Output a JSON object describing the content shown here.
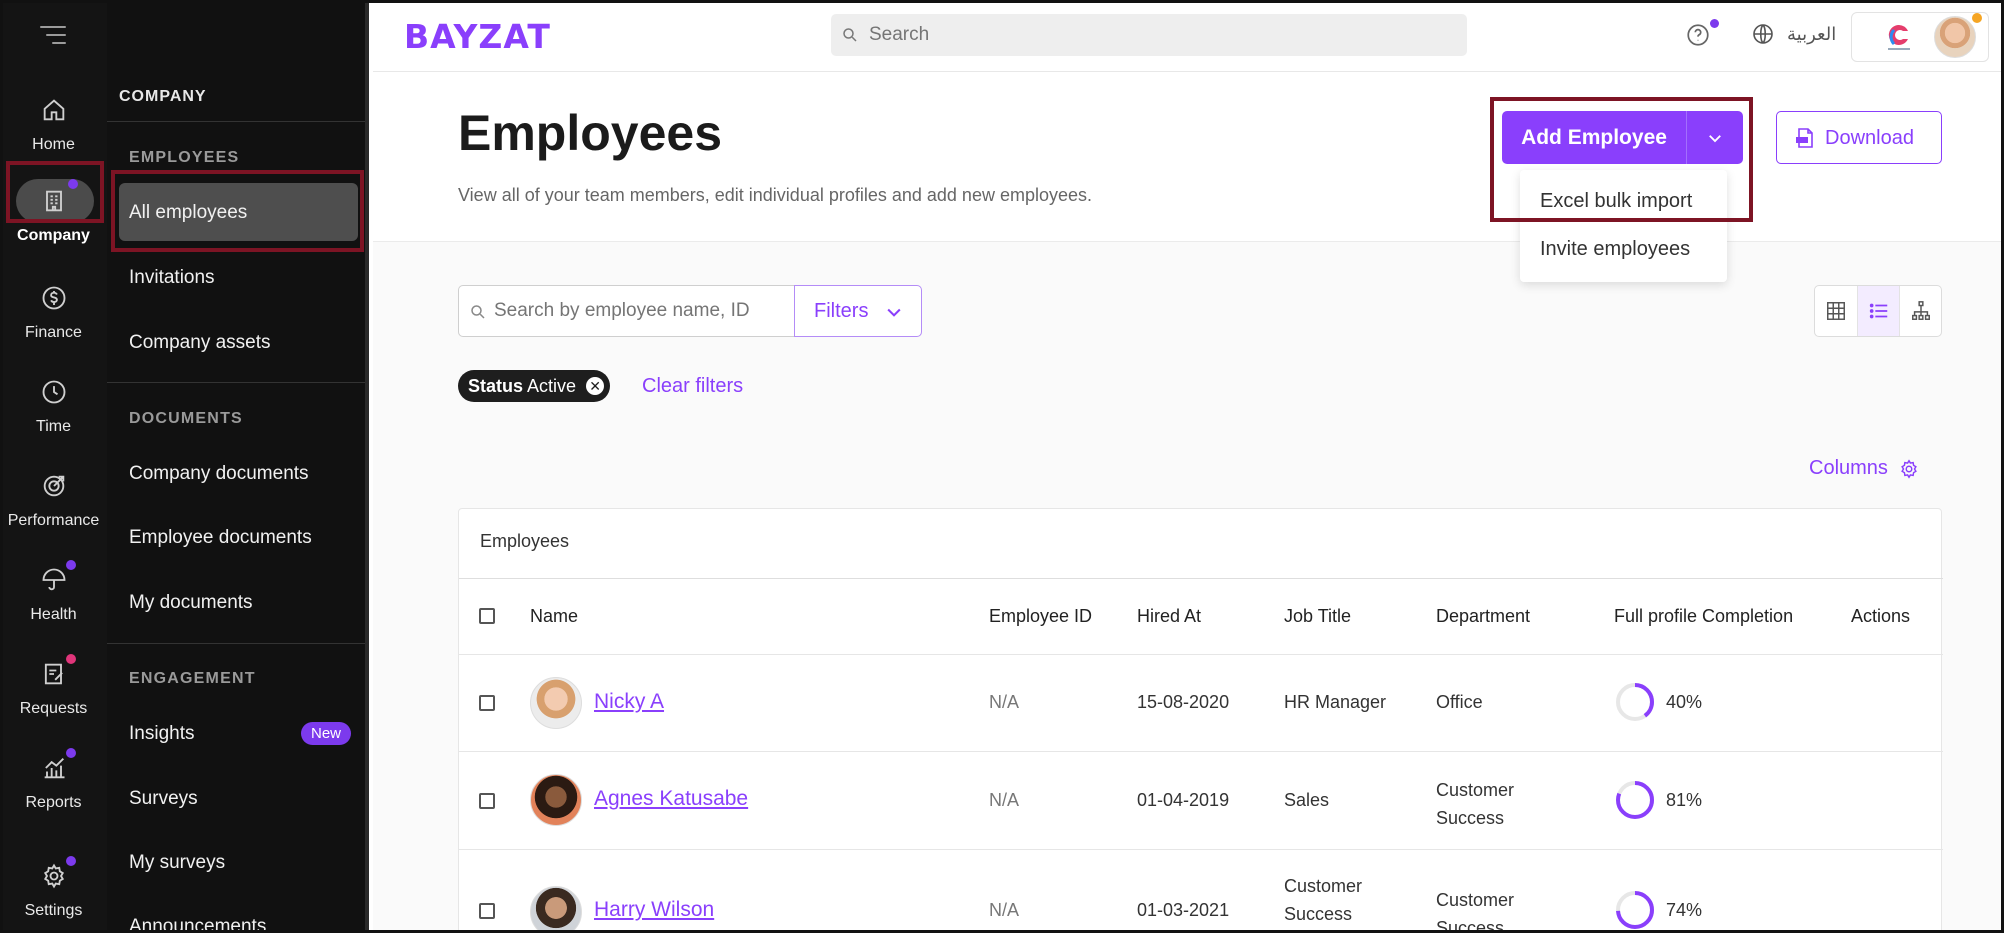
{
  "rail": {
    "items": [
      {
        "label": "Home",
        "icon": "home-icon"
      },
      {
        "label": "Company",
        "icon": "building-icon",
        "active": true
      },
      {
        "label": "Finance",
        "icon": "dollar-icon"
      },
      {
        "label": "Time",
        "icon": "clock-icon"
      },
      {
        "label": "Performance",
        "icon": "target-icon"
      },
      {
        "label": "Health",
        "icon": "umbrella-icon"
      },
      {
        "label": "Requests",
        "icon": "clipboard-icon"
      },
      {
        "label": "Reports",
        "icon": "chart-icon"
      },
      {
        "label": "Settings",
        "icon": "gear-icon"
      }
    ]
  },
  "subnav": {
    "title": "COMPANY",
    "sections": {
      "employees": "EMPLOYEES",
      "documents": "DOCUMENTS",
      "engagement": "ENGAGEMENT"
    },
    "items": {
      "all_employees": "All employees",
      "invitations": "Invitations",
      "company_assets": "Company assets",
      "company_documents": "Company documents",
      "employee_documents": "Employee documents",
      "my_documents": "My documents",
      "insights": "Insights",
      "insights_badge": "New",
      "surveys": "Surveys",
      "my_surveys": "My surveys",
      "announcements": "Announcements"
    }
  },
  "topbar": {
    "logo": "BAYZAT",
    "search_placeholder": "Search",
    "language": "العربية"
  },
  "header": {
    "title": "Employees",
    "subtitle": "View all of your team members, edit individual profiles and add new employees.",
    "add_button": "Add Employee",
    "download_button": "Download",
    "dropdown": [
      "Excel bulk import",
      "Invite employees"
    ]
  },
  "filters": {
    "search_placeholder": "Search by employee name, ID",
    "filters_button": "Filters",
    "chip_key": "Status",
    "chip_value": "Active",
    "clear": "Clear filters",
    "columns": "Columns"
  },
  "table": {
    "caption": "Employees",
    "headers": {
      "name": "Name",
      "employee_id": "Employee ID",
      "hired_at": "Hired At",
      "job_title": "Job Title",
      "department": "Department",
      "completion": "Full profile Completion",
      "actions": "Actions"
    },
    "rows": [
      {
        "name": "Nicky A",
        "employee_id": "N/A",
        "hired_at": "15-08-2020",
        "job_title": "HR Manager",
        "department": "Office",
        "completion": "40%",
        "completion_value": 0.4
      },
      {
        "name": "Agnes Katusabe",
        "employee_id": "N/A",
        "hired_at": "01-04-2019",
        "job_title": "Sales",
        "department": "Customer Success",
        "completion": "81%",
        "completion_value": 0.81
      },
      {
        "name": "Harry Wilson",
        "employee_id": "N/A",
        "hired_at": "01-03-2021",
        "job_title": "Customer Success",
        "department": "Customer Success",
        "completion": "74%",
        "completion_value": 0.74
      }
    ]
  },
  "colors": {
    "accent": "#8a3ffc",
    "highlight_box": "#7d1424",
    "dot_purple": "#7c3aed",
    "dot_pink": "#e0357a"
  }
}
